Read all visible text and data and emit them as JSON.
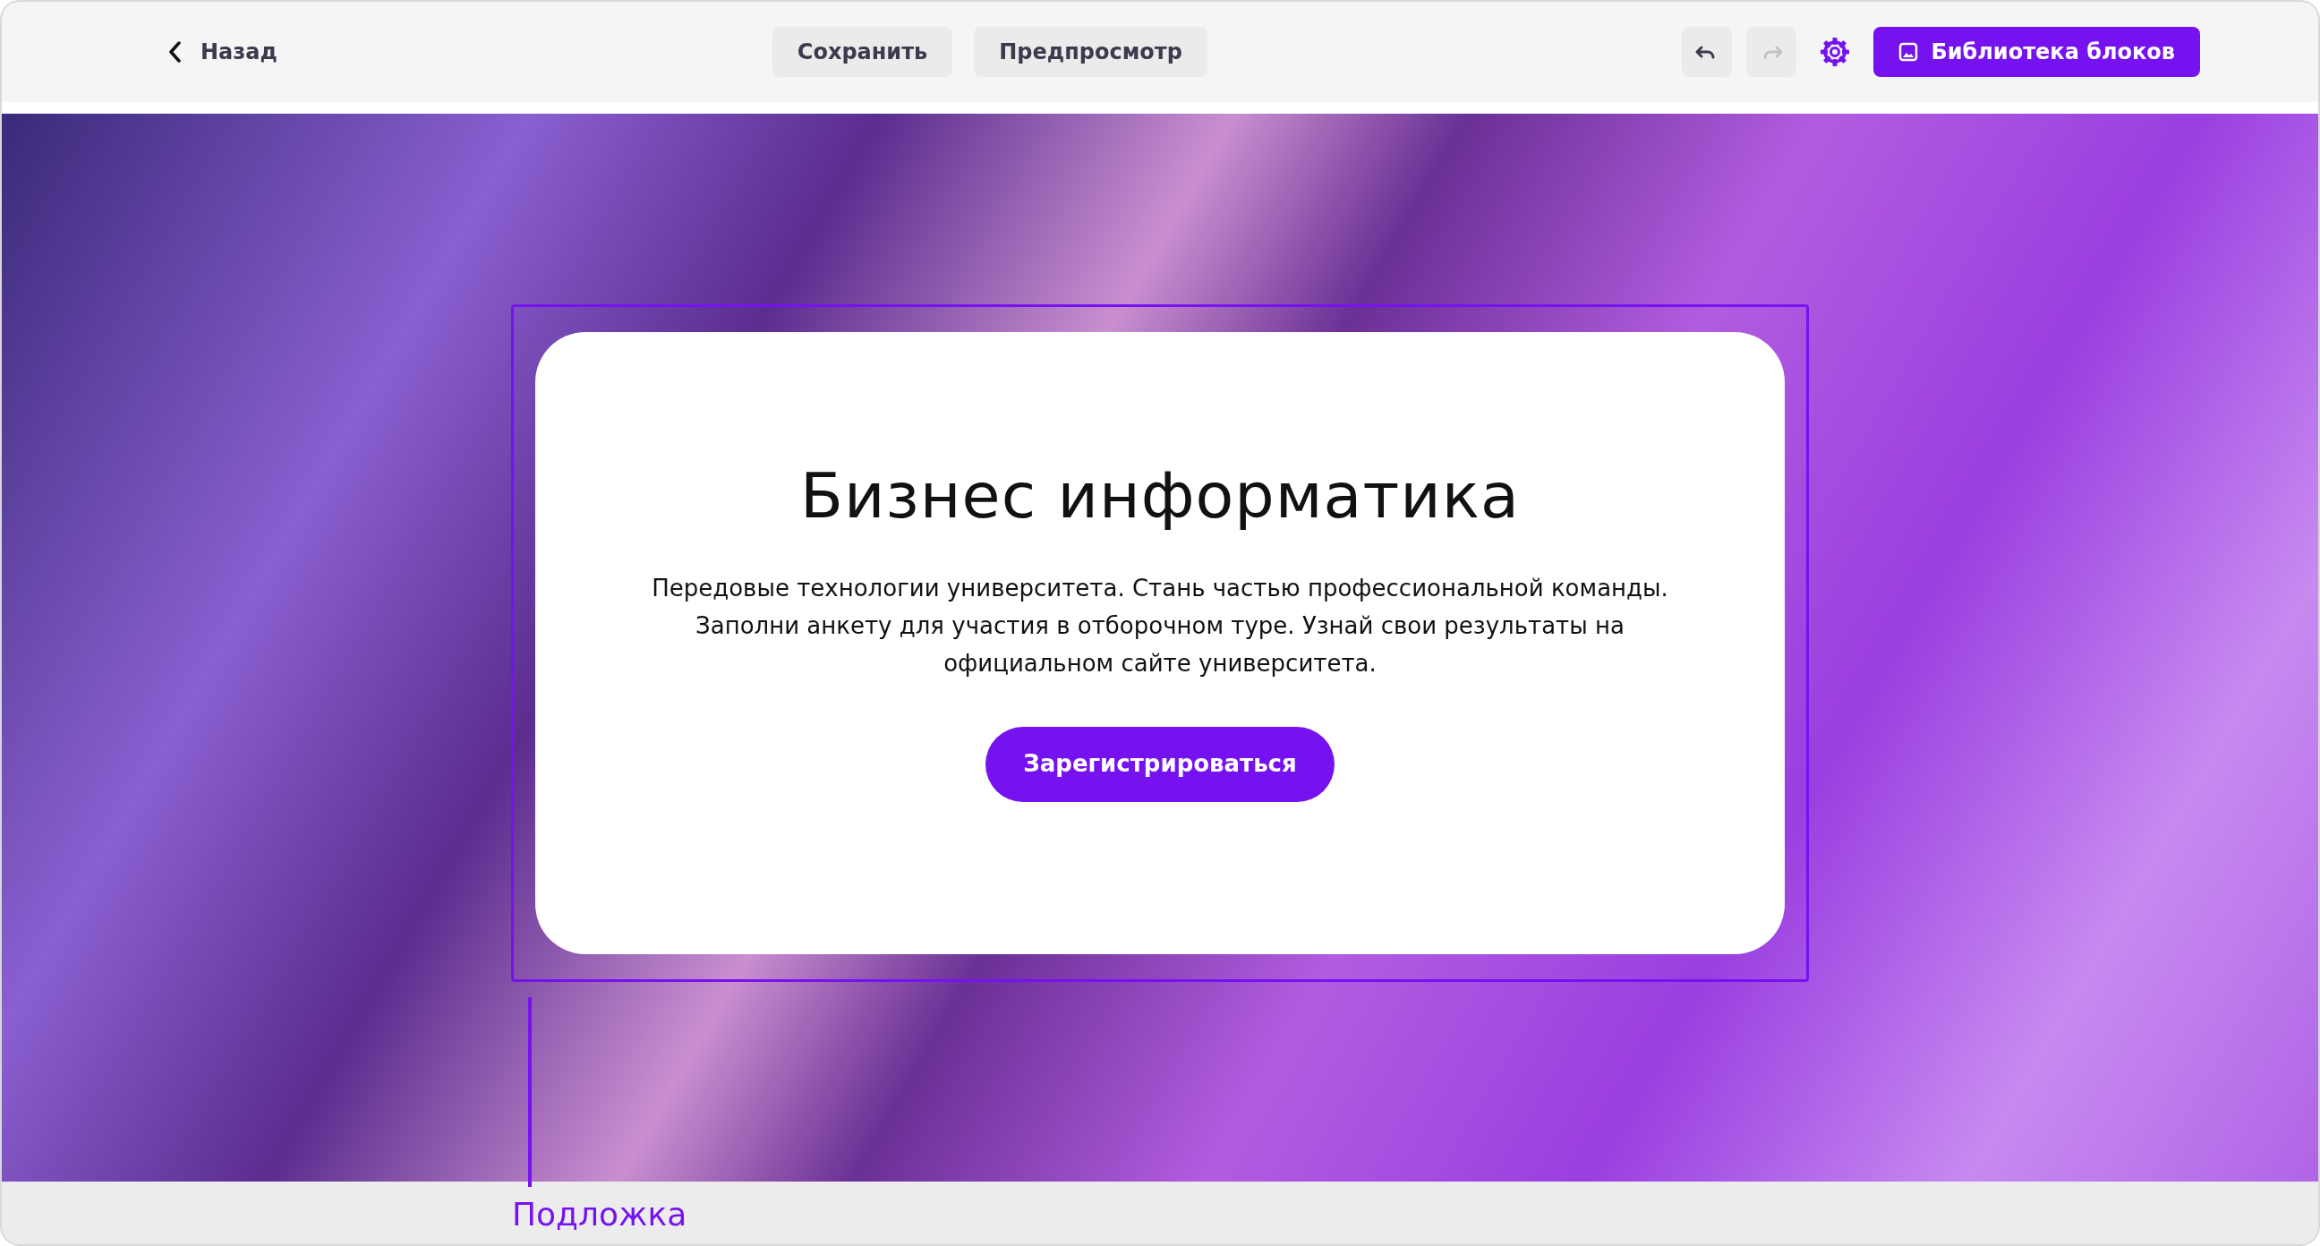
{
  "toolbar": {
    "back": {
      "label": "Назад"
    },
    "actions": [
      {
        "label": "Сохранить"
      },
      {
        "label": "Предпросмотр"
      }
    ],
    "history": [
      {
        "kind": "undo",
        "disabled": false
      },
      {
        "kind": "redo",
        "disabled": true
      }
    ],
    "library_button": {
      "label": "Библиотека блоков"
    }
  },
  "hero": {
    "title": "Бизнес информатика",
    "text": "Передовые технологии университета. Стань частью профессиональной команды. Заполни анкету для участия в отборочном туре. Узнай свои результаты на официальном сайте университета.",
    "button": {
      "label": "Зарегистрироваться"
    },
    "selected": true
  },
  "annotation": {
    "label": "Подложка"
  }
}
